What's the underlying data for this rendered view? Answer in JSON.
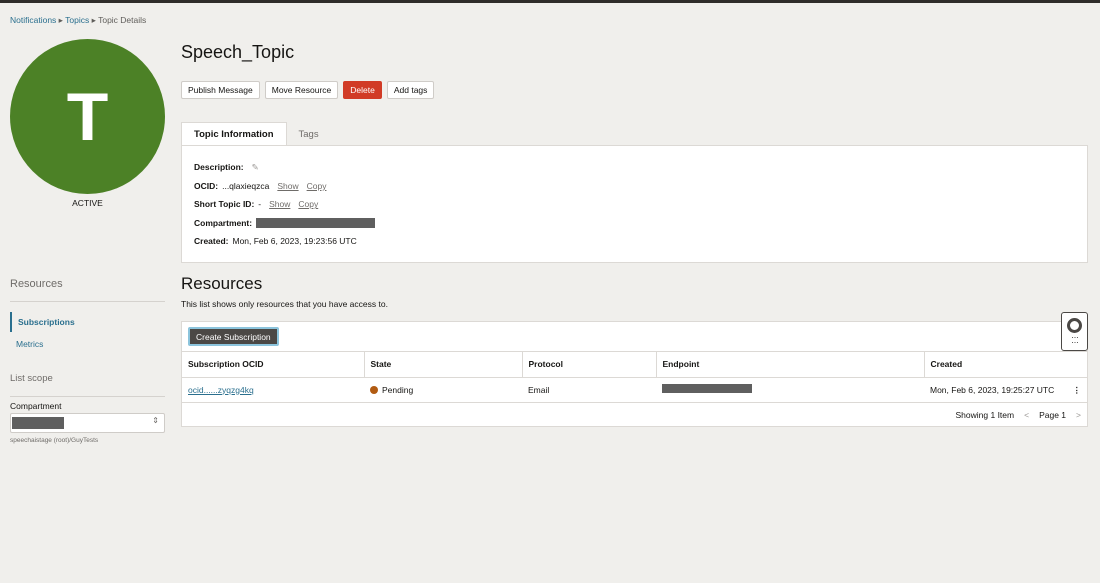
{
  "breadcrumb": [
    "Notifications",
    "Topics",
    "Topic Details"
  ],
  "topic": {
    "initial": "T",
    "status": "ACTIVE",
    "name": "Speech_Topic"
  },
  "actions": [
    "Publish Message",
    "Move Resource",
    "Delete",
    "Add tags"
  ],
  "tabs": [
    "Topic Information",
    "Tags"
  ],
  "info": {
    "description_label": "Description:",
    "ocid_label": "OCID:",
    "ocid_value": "...qlaxieqzca",
    "short_id_label": "Short Topic ID:",
    "short_id_value": "-",
    "show": "Show",
    "copy": "Copy",
    "compartment_label": "Compartment:",
    "created_label": "Created:",
    "created_value": "Mon, Feb 6, 2023, 19:23:56 UTC"
  },
  "resources": {
    "title": "Resources",
    "subtitle": "This list shows only resources that you have access to.",
    "create_button": "Create Subscription",
    "columns": [
      "Subscription OCID",
      "State",
      "Protocol",
      "Endpoint",
      "Created"
    ],
    "rows": [
      {
        "ocid": "ocid......zyqzg4kq",
        "state": "Pending",
        "protocol": "Email",
        "created": "Mon, Feb 6, 2023, 19:25:27 UTC"
      }
    ],
    "showing": "Showing 1 Item",
    "page": "Page 1",
    "pending_color": "#b15b12"
  },
  "sidebar": {
    "title": "Resources",
    "items": [
      "Subscriptions",
      "Metrics"
    ],
    "scope_title": "List scope",
    "compartment_label": "Compartment",
    "compartment_path": "speechaistage (root)/GuyTests"
  }
}
